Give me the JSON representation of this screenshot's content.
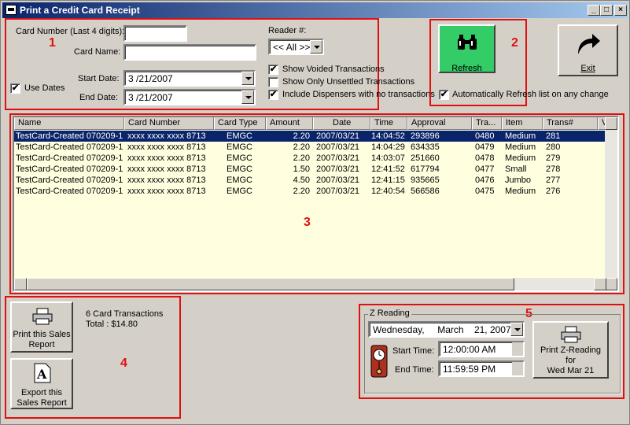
{
  "window": {
    "title": "Print a Credit Card Receipt"
  },
  "annotations": {
    "n1": "1",
    "n2": "2",
    "n3": "3",
    "n4": "4",
    "n5": "5"
  },
  "filters": {
    "card_number_label": "Card Number (Last 4 digits):",
    "card_number_value": "",
    "card_name_label": "Card Name:",
    "card_name_value": "",
    "use_dates_label": "Use Dates",
    "use_dates_checked": "✔",
    "start_date_label": "Start Date:",
    "start_date_value": "3 /21/2007",
    "end_date_label": "End Date:",
    "end_date_value": "3 /21/2007",
    "reader_label": "Reader #:",
    "reader_value": "<< All >>",
    "show_voided_label": "Show Voided Transactions",
    "show_voided_checked": "✔",
    "show_unsettled_label": "Show Only Unsettled Transactions",
    "show_unsettled_checked": "",
    "include_dispensers_label": "Include Dispensers with no transactions",
    "include_dispensers_checked": "✔"
  },
  "refresh": {
    "label": "Refresh",
    "auto_label": "Automatically Refresh list on any change",
    "auto_checked": "✔",
    "icon": "binoculars-icon",
    "color": "#33cc66"
  },
  "exit": {
    "label": "Exit",
    "icon": "arrow-curved-icon"
  },
  "grid": {
    "columns": [
      "Name",
      "Card Number",
      "Card Type",
      "Amount",
      "Date",
      "Time",
      "Approval",
      "Tra...",
      "Item",
      "Trans#",
      "Voide"
    ],
    "rows": [
      [
        "TestCard-Created 070209-1",
        "xxxx xxxx xxxx 8713",
        "EMGC",
        "2.20",
        "2007/03/21",
        "14:04:52",
        "293896",
        "0480",
        "Medium",
        "281"
      ],
      [
        "TestCard-Created 070209-1",
        "xxxx xxxx xxxx 8713",
        "EMGC",
        "2.20",
        "2007/03/21",
        "14:04:29",
        "634335",
        "0479",
        "Medium",
        "280"
      ],
      [
        "TestCard-Created 070209-1",
        "xxxx xxxx xxxx 8713",
        "EMGC",
        "2.20",
        "2007/03/21",
        "14:03:07",
        "251660",
        "0478",
        "Medium",
        "279"
      ],
      [
        "TestCard-Created 070209-1",
        "xxxx xxxx xxxx 8713",
        "EMGC",
        "1.50",
        "2007/03/21",
        "12:41:52",
        "617794",
        "0477",
        "Small",
        "278"
      ],
      [
        "TestCard-Created 070209-1",
        "xxxx xxxx xxxx 8713",
        "EMGC",
        "4.50",
        "2007/03/21",
        "12:41:15",
        "935665",
        "0476",
        "Jumbo",
        "277"
      ],
      [
        "TestCard-Created 070209-1",
        "xxxx xxxx xxxx 8713",
        "EMGC",
        "2.20",
        "2007/03/21",
        "12:40:54",
        "566586",
        "0475",
        "Medium",
        "276"
      ]
    ],
    "selected_row": 0
  },
  "report": {
    "print_label_1": "Print this Sales",
    "print_label_2": "Report",
    "export_label_1": "Export this",
    "export_label_2": "Sales Report",
    "summary_count": "6 Card Transactions",
    "summary_total": "Total : $14.80"
  },
  "zreading": {
    "group_label": "Z Reading",
    "date_value": "Wednesday,     March    21, 2007",
    "start_label": "Start Time:",
    "start_value": "12:00:00 AM",
    "end_label": "End Time:",
    "end_value": "11:59:59 PM",
    "print_label_1": "Print Z-Reading",
    "print_label_2": "for",
    "print_label_3": "Wed Mar 21"
  }
}
